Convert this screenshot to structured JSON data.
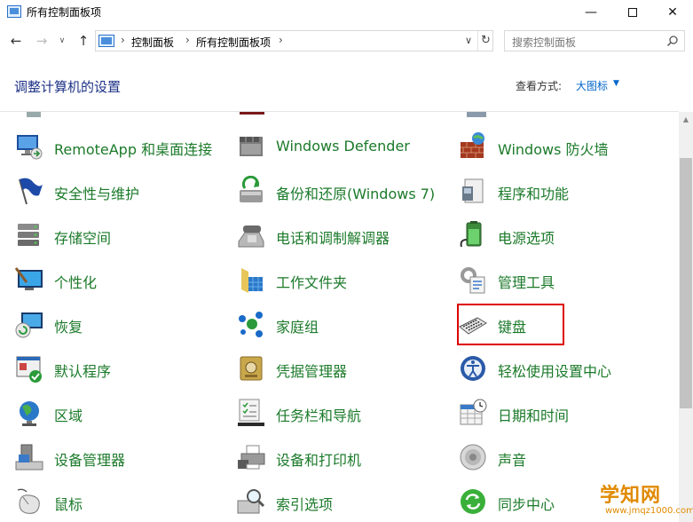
{
  "window": {
    "title": "所有控制面板项",
    "minimize": "—",
    "close": "✕"
  },
  "nav": {
    "back": "←",
    "forward": "→",
    "history": "∨",
    "up": "↑",
    "breadcrumbs": [
      "控制面板",
      "所有控制面板项"
    ],
    "separator": "›",
    "dropdown": "∨",
    "refresh": "↻"
  },
  "search": {
    "placeholder": "搜索控制面板"
  },
  "header": {
    "title": "调整计算机的设置",
    "view_by_label": "查看方式:",
    "view_by_value": "大图标",
    "view_by_arrow": "▼"
  },
  "items": [
    {
      "label": "RemoteApp 和桌面连接",
      "icon": "remoteapp-icon"
    },
    {
      "label": "Windows Defender",
      "icon": "defender-icon"
    },
    {
      "label": "Windows 防火墙",
      "icon": "firewall-icon"
    },
    {
      "label": "安全性与维护",
      "icon": "flag-icon"
    },
    {
      "label": "备份和还原(Windows 7)",
      "icon": "backup-icon"
    },
    {
      "label": "程序和功能",
      "icon": "programs-icon"
    },
    {
      "label": "存储空间",
      "icon": "storage-icon"
    },
    {
      "label": "电话和调制解调器",
      "icon": "phone-icon"
    },
    {
      "label": "电源选项",
      "icon": "power-icon"
    },
    {
      "label": "个性化",
      "icon": "personalize-icon"
    },
    {
      "label": "工作文件夹",
      "icon": "folder-icon"
    },
    {
      "label": "管理工具",
      "icon": "admin-tools-icon"
    },
    {
      "label": "恢复",
      "icon": "recovery-icon"
    },
    {
      "label": "家庭组",
      "icon": "homegroup-icon"
    },
    {
      "label": "键盘",
      "icon": "keyboard-icon"
    },
    {
      "label": "默认程序",
      "icon": "default-programs-icon"
    },
    {
      "label": "凭据管理器",
      "icon": "credential-icon"
    },
    {
      "label": "轻松使用设置中心",
      "icon": "ease-access-icon"
    },
    {
      "label": "区域",
      "icon": "region-icon"
    },
    {
      "label": "任务栏和导航",
      "icon": "taskbar-icon"
    },
    {
      "label": "日期和时间",
      "icon": "calendar-icon"
    },
    {
      "label": "设备管理器",
      "icon": "device-manager-icon"
    },
    {
      "label": "设备和打印机",
      "icon": "printer-icon"
    },
    {
      "label": "声音",
      "icon": "sound-icon"
    },
    {
      "label": "鼠标",
      "icon": "mouse-icon"
    },
    {
      "label": "索引选项",
      "icon": "index-icon"
    },
    {
      "label": "同步中心",
      "icon": "sync-icon"
    }
  ],
  "watermark": {
    "title": "学知网",
    "url": "www.jmqz1000.com"
  },
  "colors": {
    "link_green": "#1b7a2a",
    "title_blue": "#1e3287",
    "accent_blue": "#0066cc",
    "highlight_red": "#dd0000"
  }
}
